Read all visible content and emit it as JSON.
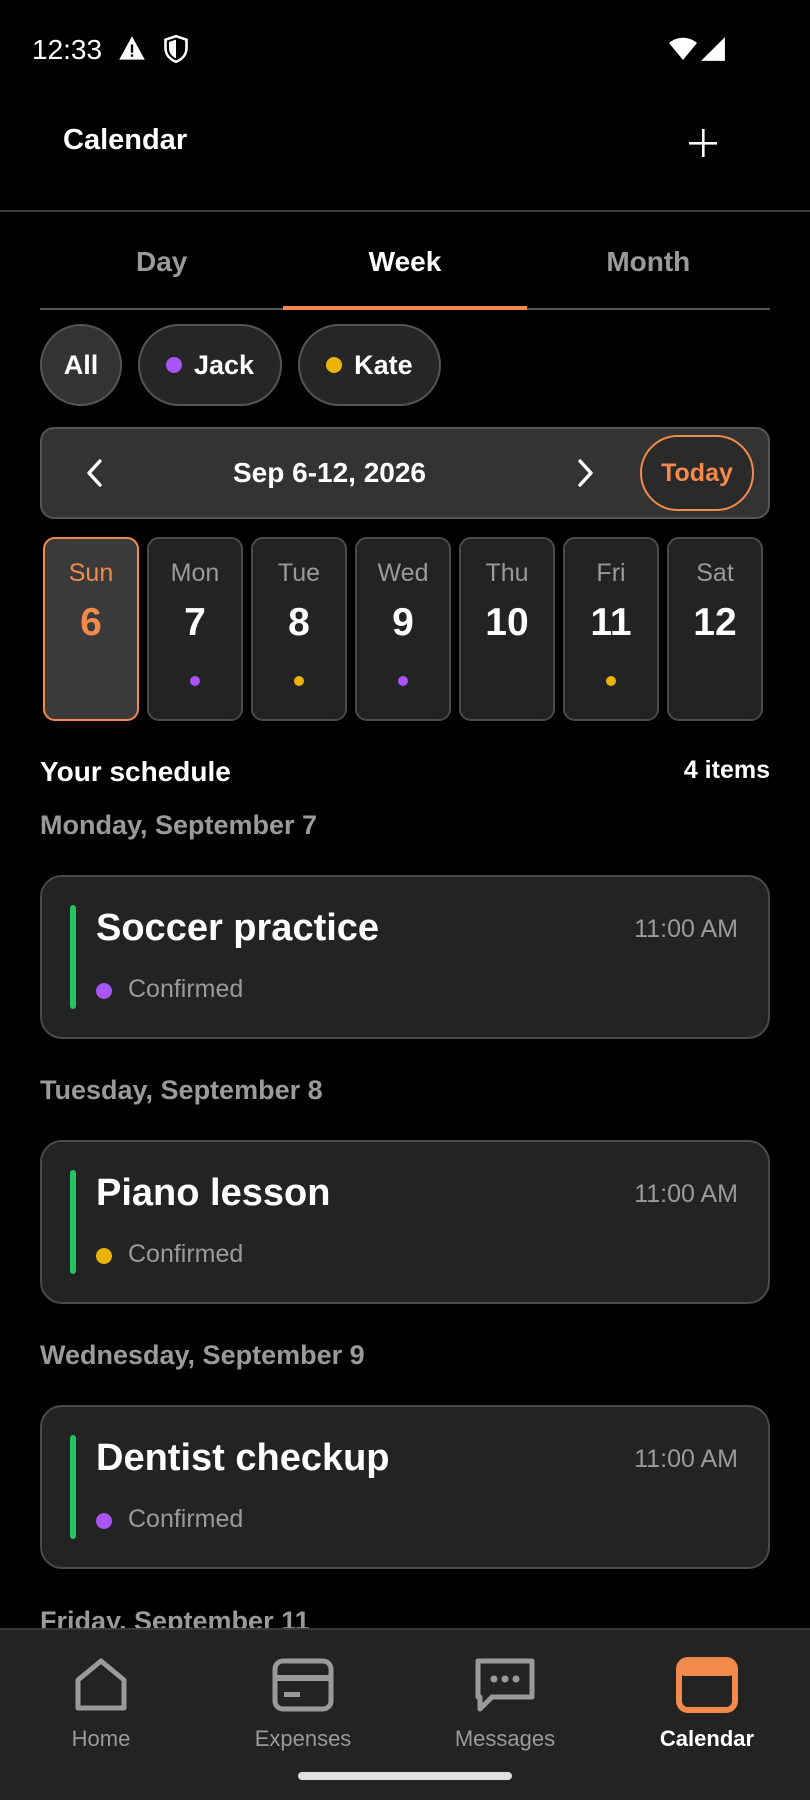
{
  "status_bar": {
    "time": "12:33"
  },
  "app_bar": {
    "title": "Calendar"
  },
  "tabs": [
    {
      "label": "Day",
      "active": false
    },
    {
      "label": "Week",
      "active": true
    },
    {
      "label": "Month",
      "active": false
    }
  ],
  "filters": [
    {
      "label": "All",
      "color": ""
    },
    {
      "label": "Jack",
      "color": "#a855f7"
    },
    {
      "label": "Kate",
      "color": "#eab308"
    }
  ],
  "week_nav": {
    "range": "Sep 6-12, 2026",
    "today_label": "Today"
  },
  "days": [
    {
      "name": "Sun",
      "num": "6",
      "dot": "",
      "selected": true
    },
    {
      "name": "Mon",
      "num": "7",
      "dot": "#a855f7",
      "selected": false
    },
    {
      "name": "Tue",
      "num": "8",
      "dot": "#eab308",
      "selected": false
    },
    {
      "name": "Wed",
      "num": "9",
      "dot": "#a855f7",
      "selected": false
    },
    {
      "name": "Thu",
      "num": "10",
      "dot": "",
      "selected": false
    },
    {
      "name": "Fri",
      "num": "11",
      "dot": "#eab308",
      "selected": false
    },
    {
      "name": "Sat",
      "num": "12",
      "dot": "",
      "selected": false
    }
  ],
  "schedule": {
    "title": "Your schedule",
    "count": "4 items",
    "groups": [
      {
        "date": "Monday, September 7",
        "event": {
          "name": "Soccer practice",
          "time": "11:00 AM",
          "status": "Confirmed",
          "dot": "#a855f7"
        }
      },
      {
        "date": "Tuesday, September 8",
        "event": {
          "name": "Piano lesson",
          "time": "11:00 AM",
          "status": "Confirmed",
          "dot": "#eab308"
        }
      },
      {
        "date": "Wednesday, September 9",
        "event": {
          "name": "Dentist checkup",
          "time": "11:00 AM",
          "status": "Confirmed",
          "dot": "#a855f7"
        }
      },
      {
        "date": "Friday, September 11"
      }
    ]
  },
  "bottom_nav": [
    {
      "label": "Home",
      "icon": "home-icon",
      "active": false
    },
    {
      "label": "Expenses",
      "icon": "card-icon",
      "active": false
    },
    {
      "label": "Messages",
      "icon": "message-icon",
      "active": false
    },
    {
      "label": "Calendar",
      "icon": "calendar-icon",
      "active": true
    }
  ],
  "colors": {
    "accent": "#f28a4c",
    "event_bar": "#22c55e"
  }
}
